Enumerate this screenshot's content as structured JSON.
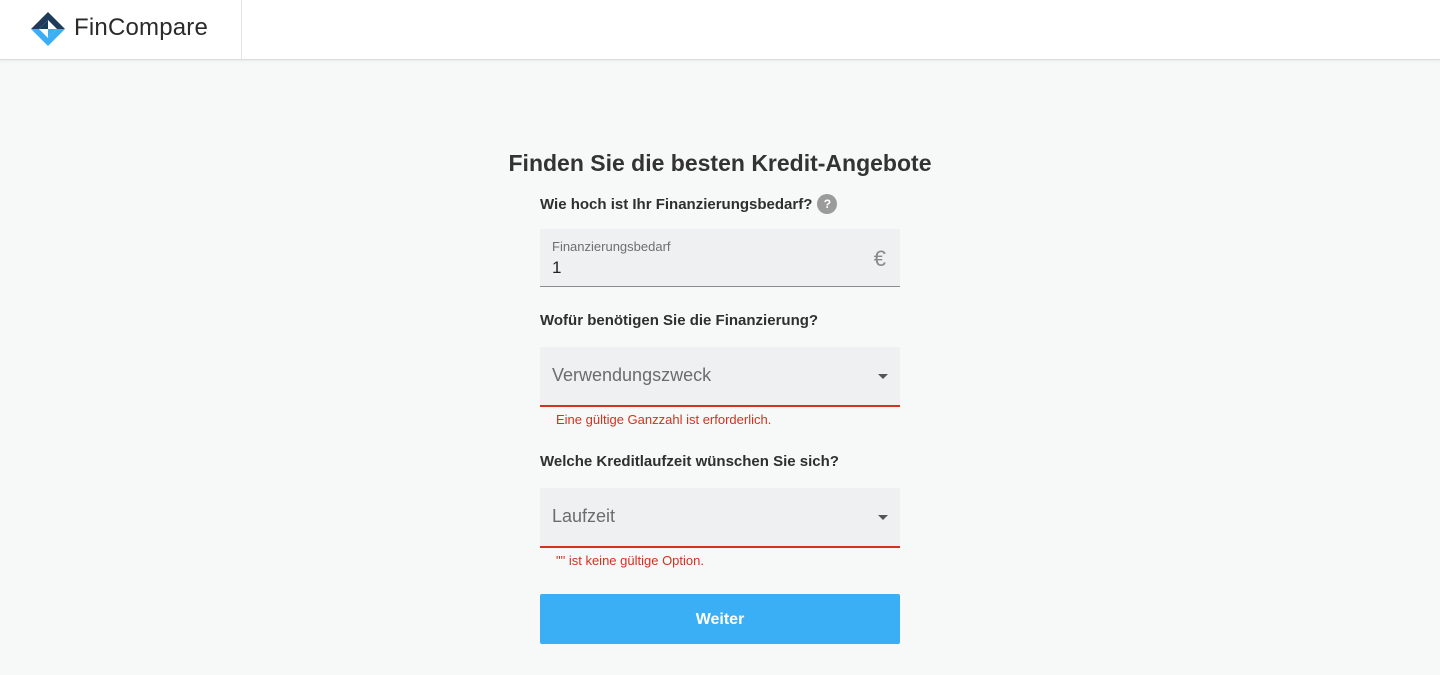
{
  "header": {
    "brand_name": "FinCompare",
    "logo_icon": "fincompare-diamond-logo"
  },
  "form": {
    "title": "Finden Sie die besten Kredit-Angebote",
    "amount": {
      "question": "Wie hoch ist Ihr Finanzierungsbedarf?",
      "help_icon": "?",
      "field_label": "Finanzierungsbedarf",
      "value": "1",
      "currency_symbol": "€"
    },
    "purpose": {
      "question": "Wofür benötigen Sie die Finanzierung?",
      "placeholder": "Verwendungszweck",
      "error": "Eine gültige Ganzzahl ist erforderlich."
    },
    "term": {
      "question": "Welche Kreditlaufzeit wünschen Sie sich?",
      "placeholder": "Laufzeit",
      "error": "\"\" ist keine gültige Option."
    },
    "submit_label": "Weiter"
  },
  "colors": {
    "accent": "#3aaff5",
    "error": "#d0331f",
    "logo_dark": "#1f3b5a",
    "logo_light": "#3aaff5"
  }
}
